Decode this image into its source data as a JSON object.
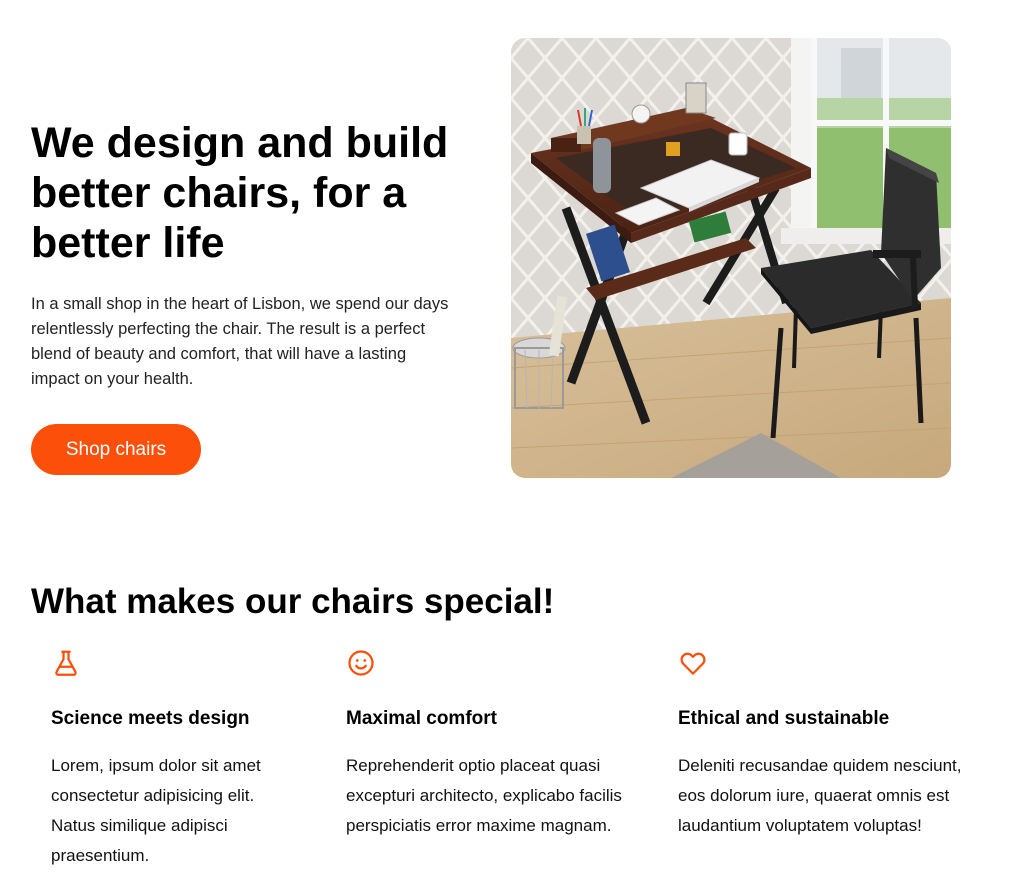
{
  "hero": {
    "title": "We design and build better chairs, for a better life",
    "description": "In a small shop in the heart of Lisbon, we spend our days relentlessly perfecting the chair. The result is a perfect blend of beauty and comfort, that will have a lasting impact on your health.",
    "cta_label": "Shop chairs",
    "image_icon": "desk-and-chair-photo"
  },
  "features": {
    "title": "What makes our chairs special!",
    "items": [
      {
        "icon": "flask-icon",
        "title": "Science meets design",
        "text": "Lorem, ipsum dolor sit amet consectetur adipisicing elit. Natus similique adipisci praesentium."
      },
      {
        "icon": "smiley-icon",
        "title": "Maximal comfort",
        "text": "Reprehenderit optio placeat quasi excepturi architecto, explicabo facilis perspiciatis error maxime magnam."
      },
      {
        "icon": "heart-icon",
        "title": "Ethical and sustainable",
        "text": "Deleniti recusandae quidem nesciunt, eos dolorum iure, quaerat omnis est laudantium voluptatem voluptas!"
      }
    ]
  },
  "colors": {
    "accent": "#fc4f0a",
    "text": "#111111",
    "background": "#ffffff"
  }
}
